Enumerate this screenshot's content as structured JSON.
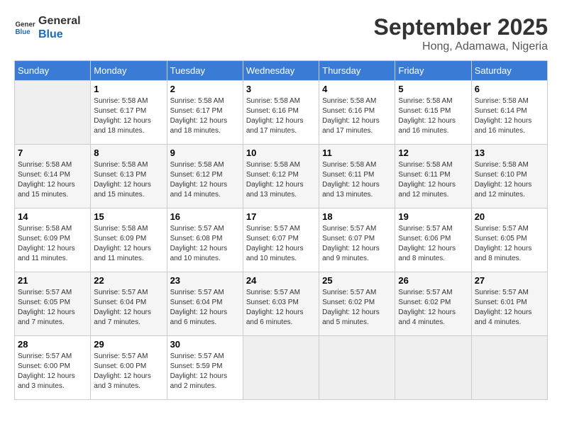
{
  "logo": {
    "line1": "General",
    "line2": "Blue"
  },
  "title": "September 2025",
  "location": "Hong, Adamawa, Nigeria",
  "headers": [
    "Sunday",
    "Monday",
    "Tuesday",
    "Wednesday",
    "Thursday",
    "Friday",
    "Saturday"
  ],
  "weeks": [
    [
      {
        "day": "",
        "info": ""
      },
      {
        "day": "1",
        "info": "Sunrise: 5:58 AM\nSunset: 6:17 PM\nDaylight: 12 hours\nand 18 minutes."
      },
      {
        "day": "2",
        "info": "Sunrise: 5:58 AM\nSunset: 6:17 PM\nDaylight: 12 hours\nand 18 minutes."
      },
      {
        "day": "3",
        "info": "Sunrise: 5:58 AM\nSunset: 6:16 PM\nDaylight: 12 hours\nand 17 minutes."
      },
      {
        "day": "4",
        "info": "Sunrise: 5:58 AM\nSunset: 6:16 PM\nDaylight: 12 hours\nand 17 minutes."
      },
      {
        "day": "5",
        "info": "Sunrise: 5:58 AM\nSunset: 6:15 PM\nDaylight: 12 hours\nand 16 minutes."
      },
      {
        "day": "6",
        "info": "Sunrise: 5:58 AM\nSunset: 6:14 PM\nDaylight: 12 hours\nand 16 minutes."
      }
    ],
    [
      {
        "day": "7",
        "info": "Sunrise: 5:58 AM\nSunset: 6:14 PM\nDaylight: 12 hours\nand 15 minutes."
      },
      {
        "day": "8",
        "info": "Sunrise: 5:58 AM\nSunset: 6:13 PM\nDaylight: 12 hours\nand 15 minutes."
      },
      {
        "day": "9",
        "info": "Sunrise: 5:58 AM\nSunset: 6:12 PM\nDaylight: 12 hours\nand 14 minutes."
      },
      {
        "day": "10",
        "info": "Sunrise: 5:58 AM\nSunset: 6:12 PM\nDaylight: 12 hours\nand 13 minutes."
      },
      {
        "day": "11",
        "info": "Sunrise: 5:58 AM\nSunset: 6:11 PM\nDaylight: 12 hours\nand 13 minutes."
      },
      {
        "day": "12",
        "info": "Sunrise: 5:58 AM\nSunset: 6:11 PM\nDaylight: 12 hours\nand 12 minutes."
      },
      {
        "day": "13",
        "info": "Sunrise: 5:58 AM\nSunset: 6:10 PM\nDaylight: 12 hours\nand 12 minutes."
      }
    ],
    [
      {
        "day": "14",
        "info": "Sunrise: 5:58 AM\nSunset: 6:09 PM\nDaylight: 12 hours\nand 11 minutes."
      },
      {
        "day": "15",
        "info": "Sunrise: 5:58 AM\nSunset: 6:09 PM\nDaylight: 12 hours\nand 11 minutes."
      },
      {
        "day": "16",
        "info": "Sunrise: 5:57 AM\nSunset: 6:08 PM\nDaylight: 12 hours\nand 10 minutes."
      },
      {
        "day": "17",
        "info": "Sunrise: 5:57 AM\nSunset: 6:07 PM\nDaylight: 12 hours\nand 10 minutes."
      },
      {
        "day": "18",
        "info": "Sunrise: 5:57 AM\nSunset: 6:07 PM\nDaylight: 12 hours\nand 9 minutes."
      },
      {
        "day": "19",
        "info": "Sunrise: 5:57 AM\nSunset: 6:06 PM\nDaylight: 12 hours\nand 8 minutes."
      },
      {
        "day": "20",
        "info": "Sunrise: 5:57 AM\nSunset: 6:05 PM\nDaylight: 12 hours\nand 8 minutes."
      }
    ],
    [
      {
        "day": "21",
        "info": "Sunrise: 5:57 AM\nSunset: 6:05 PM\nDaylight: 12 hours\nand 7 minutes."
      },
      {
        "day": "22",
        "info": "Sunrise: 5:57 AM\nSunset: 6:04 PM\nDaylight: 12 hours\nand 7 minutes."
      },
      {
        "day": "23",
        "info": "Sunrise: 5:57 AM\nSunset: 6:04 PM\nDaylight: 12 hours\nand 6 minutes."
      },
      {
        "day": "24",
        "info": "Sunrise: 5:57 AM\nSunset: 6:03 PM\nDaylight: 12 hours\nand 6 minutes."
      },
      {
        "day": "25",
        "info": "Sunrise: 5:57 AM\nSunset: 6:02 PM\nDaylight: 12 hours\nand 5 minutes."
      },
      {
        "day": "26",
        "info": "Sunrise: 5:57 AM\nSunset: 6:02 PM\nDaylight: 12 hours\nand 4 minutes."
      },
      {
        "day": "27",
        "info": "Sunrise: 5:57 AM\nSunset: 6:01 PM\nDaylight: 12 hours\nand 4 minutes."
      }
    ],
    [
      {
        "day": "28",
        "info": "Sunrise: 5:57 AM\nSunset: 6:00 PM\nDaylight: 12 hours\nand 3 minutes."
      },
      {
        "day": "29",
        "info": "Sunrise: 5:57 AM\nSunset: 6:00 PM\nDaylight: 12 hours\nand 3 minutes."
      },
      {
        "day": "30",
        "info": "Sunrise: 5:57 AM\nSunset: 5:59 PM\nDaylight: 12 hours\nand 2 minutes."
      },
      {
        "day": "",
        "info": ""
      },
      {
        "day": "",
        "info": ""
      },
      {
        "day": "",
        "info": ""
      },
      {
        "day": "",
        "info": ""
      }
    ]
  ]
}
